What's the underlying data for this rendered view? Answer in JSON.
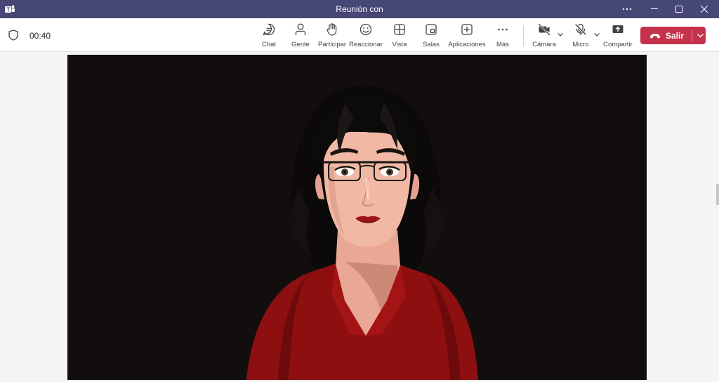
{
  "window": {
    "title": "Reunión con"
  },
  "meeting": {
    "duration": "00:40"
  },
  "toolbar": {
    "chat": "Chat",
    "people": "Gente",
    "raise": "Participar",
    "react": "Reaccionar",
    "view": "Vista",
    "rooms": "Salas",
    "apps": "Aplicaciones",
    "more": "Más",
    "camera": "Cámara",
    "mic": "Micro",
    "share": "Compartir",
    "leave": "Salir"
  },
  "colors": {
    "titlebar": "#464775",
    "leave": "#c4314b",
    "video_bg": "#130e0e",
    "shirt": "#9a1111"
  }
}
